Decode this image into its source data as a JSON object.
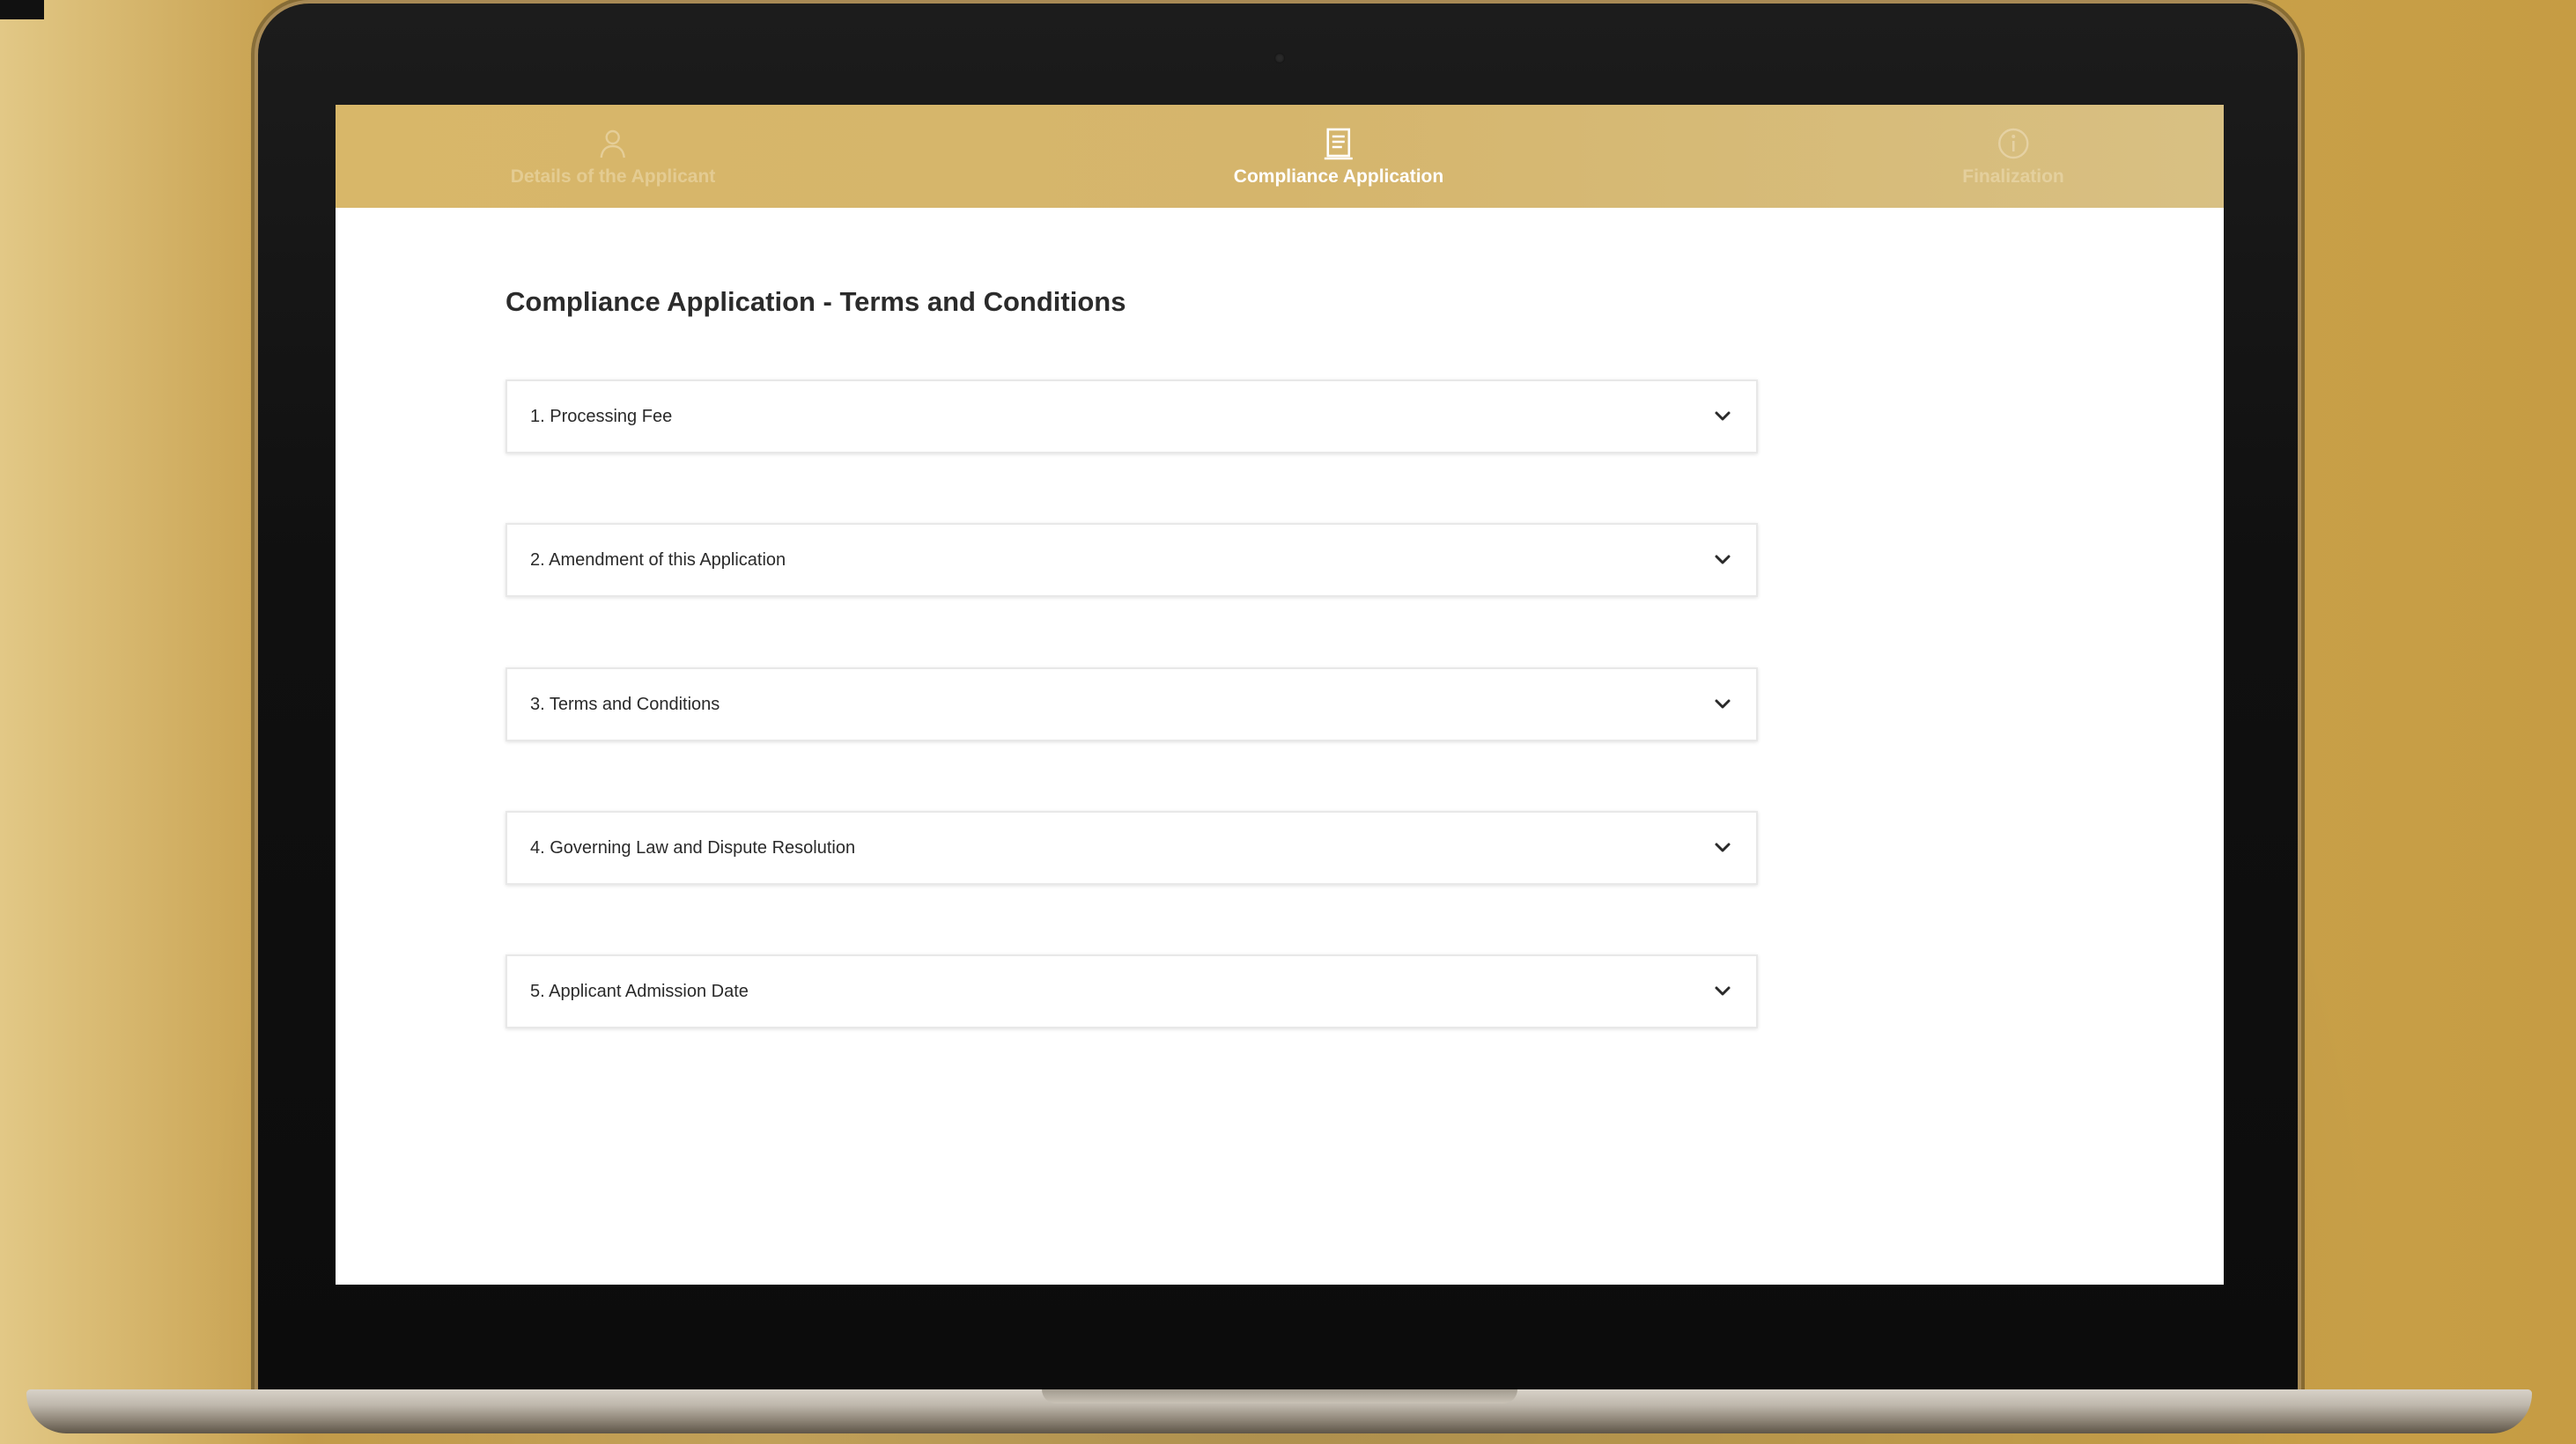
{
  "stepper": {
    "steps": [
      {
        "label": "Details of the Applicant",
        "icon": "user-icon",
        "state": "inactive"
      },
      {
        "label": "Compliance Application",
        "icon": "document-icon",
        "state": "active"
      },
      {
        "label": "Finalization",
        "icon": "info-icon",
        "state": "inactive"
      }
    ]
  },
  "page": {
    "title": "Compliance Application - Terms and Conditions"
  },
  "accordion": {
    "items": [
      {
        "label": "1. Processing Fee"
      },
      {
        "label": "2. Amendment of this Application"
      },
      {
        "label": "3. Terms and Conditions"
      },
      {
        "label": "4. Governing Law and Dispute Resolution"
      },
      {
        "label": "5. Applicant Admission Date"
      }
    ]
  },
  "colors": {
    "accent": "#d6b66b",
    "background": "#cfab5c",
    "text": "#2b2b2b"
  }
}
